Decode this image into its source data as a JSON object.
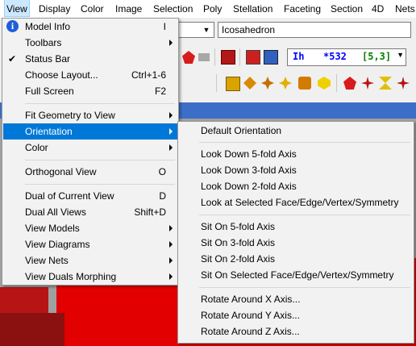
{
  "menubar": {
    "items": [
      "View",
      "Display",
      "Color",
      "Image",
      "Selection",
      "Poly",
      "Stellation",
      "Faceting",
      "Section",
      "4D",
      "Nets"
    ]
  },
  "toolbar": {
    "polyhedron_dropdown": "Icosahedron",
    "symmetry": {
      "group": "Ih",
      "order": "*532",
      "schlafli": "[5,3]"
    },
    "colors": {
      "symmetry_group": "#0000ff",
      "schlafli": "#008000"
    }
  },
  "view_menu": {
    "items": [
      {
        "label": "Model Info",
        "shortcut": "I",
        "icon": "info-icon"
      },
      {
        "label": "Toolbars",
        "submenu": true
      },
      {
        "label": "Status Bar",
        "checked": true,
        "icon": "check-icon"
      },
      {
        "label": "Choose Layout...",
        "shortcut": "Ctrl+1-6"
      },
      {
        "label": "Full Screen",
        "shortcut": "F2"
      },
      {
        "label": "Fit Geometry to View",
        "submenu": true
      },
      {
        "label": "Orientation",
        "submenu": true,
        "highlighted": true
      },
      {
        "label": "Color",
        "submenu": true
      },
      {
        "label": "Orthogonal View",
        "shortcut": "O"
      },
      {
        "label": "Dual of Current View",
        "shortcut": "D"
      },
      {
        "label": "Dual All Views",
        "shortcut": "Shift+D"
      },
      {
        "label": "View Models",
        "submenu": true
      },
      {
        "label": "View Diagrams",
        "submenu": true
      },
      {
        "label": "View Nets",
        "submenu": true
      },
      {
        "label": "View Duals Morphing",
        "submenu": true
      }
    ]
  },
  "orientation_submenu": {
    "items": [
      "Default Orientation",
      "Look Down 5-fold Axis",
      "Look Down 3-fold Axis",
      "Look Down 2-fold Axis",
      "Look at Selected Face/Edge/Vertex/Symmetry",
      "Sit On 5-fold Axis",
      "Sit On 3-fold Axis",
      "Sit On 2-fold Axis",
      "Sit On Selected Face/Edge/Vertex/Symmetry",
      "Rotate Around X Axis...",
      "Rotate Around Y Axis...",
      "Rotate Around Z Axis..."
    ]
  },
  "theme": {
    "highlight": "#0078d7",
    "workspace_red": "#e30000"
  }
}
